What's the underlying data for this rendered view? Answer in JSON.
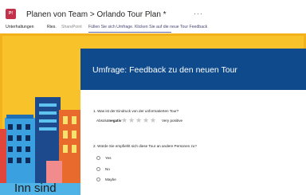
{
  "header": {
    "app_icon_letter": "P!",
    "breadcrumb": "Planen von Team > Orlando Tour Plan *",
    "more_icon": "···"
  },
  "tabs": [
    {
      "label": "Unterhaltungen"
    },
    {
      "label": "Ries."
    },
    {
      "label": "SharePoint"
    },
    {
      "label": "Füllen Sie sich Umfrage. Klicken Sie auf die neue Tour Feedback"
    }
  ],
  "illustration": {
    "text": "Inn sind"
  },
  "form": {
    "title": "Umfrage: Feedback zu den neuen Tour",
    "q1": {
      "text": "1. Was ist der Eindruck von der unformatierten Tour?",
      "low_prefix": "Absolut",
      "low_bold": "negativ",
      "high_label": "Very positive",
      "stars": 5
    },
    "q2": {
      "text": "2. Würde Sie empfiehlt sich diese Tour an andere Personen zu?",
      "options": [
        "Yes",
        "No",
        "Maybe"
      ]
    }
  },
  "colors": {
    "canvas": "#f7c22a",
    "form_header": "#0e4a8c",
    "app_icon": "#c4314b",
    "tab_accent": "#6264a7"
  }
}
